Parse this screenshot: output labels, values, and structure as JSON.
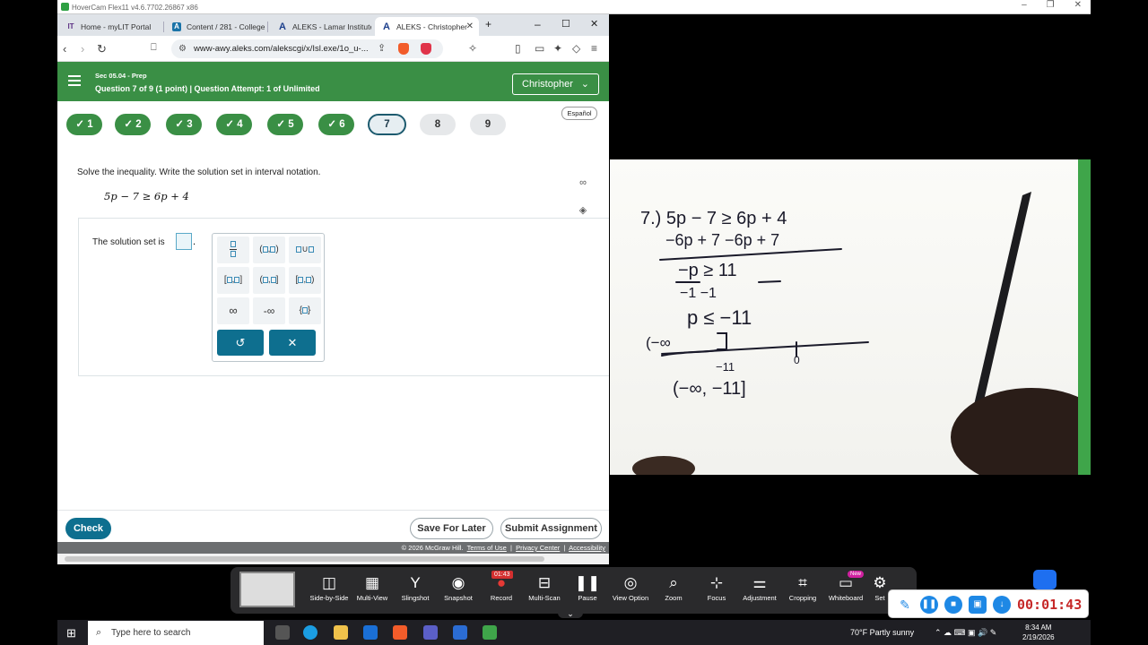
{
  "hovercam": {
    "title": "HoverCam Flex11 v4.6.7702.26867 x86",
    "toolbar": [
      {
        "label": "Side-by-Side",
        "icon": "side-by-side-icon"
      },
      {
        "label": "Multi-View",
        "icon": "multi-view-icon"
      },
      {
        "label": "Slingshot",
        "icon": "slingshot-icon"
      },
      {
        "label": "Snapshot",
        "icon": "snapshot-icon"
      },
      {
        "label": "Record",
        "icon": "record-icon"
      },
      {
        "label": "Multi-Scan",
        "icon": "multi-scan-icon"
      },
      {
        "label": "Pause",
        "icon": "pause-icon"
      },
      {
        "label": "View Option",
        "icon": "eye-icon"
      },
      {
        "label": "Zoom",
        "icon": "zoom-icon"
      },
      {
        "label": "Focus",
        "icon": "focus-icon"
      },
      {
        "label": "Adjustment",
        "icon": "adjustment-icon"
      },
      {
        "label": "Cropping",
        "icon": "crop-icon"
      },
      {
        "label": "Whiteboard",
        "icon": "whiteboard-icon"
      },
      {
        "label": "Set",
        "icon": "gear-icon"
      }
    ],
    "record_badge": "01:43",
    "new_badge": "New",
    "recording_time": "00:01:43"
  },
  "browser": {
    "tabs": [
      {
        "label": "Home - myLIT Portal"
      },
      {
        "label": "Content / 281 - College"
      },
      {
        "label": "ALEKS - Lamar Institute"
      },
      {
        "label": "ALEKS - Christopher"
      }
    ],
    "url": "www-awy.aleks.com/alekscgi/x/Isl.exe/1o_u-..."
  },
  "aleks": {
    "section": "Sec 05.04 - Prep",
    "question_info": "Question 7 of 9 (1 point)  |  Question Attempt: 1 of Unlimited",
    "user": "Christopher",
    "espanol": "Español",
    "questions": [
      "1",
      "2",
      "3",
      "4",
      "5",
      "6",
      "7",
      "8",
      "9"
    ],
    "current_question": 7,
    "prompt": "Solve the inequality. Write the solution set in interval notation.",
    "equation": "5p − 7 ≥ 6p + 4",
    "solution_label": "The solution set is",
    "palette": {
      "infinity": "∞",
      "neg_infinity": "-∞"
    },
    "check": "Check",
    "save_later": "Save For Later",
    "submit": "Submit Assignment",
    "footer": {
      "copyright": "© 2026 McGraw Hill.",
      "terms": "Terms of Use",
      "privacy": "Privacy Center",
      "accessibility": "Accessibility"
    }
  },
  "taskbar": {
    "search_placeholder": "Type here to search",
    "weather": "70°F  Partly sunny",
    "time": "8:34 AM",
    "date": "2/19/2026"
  }
}
